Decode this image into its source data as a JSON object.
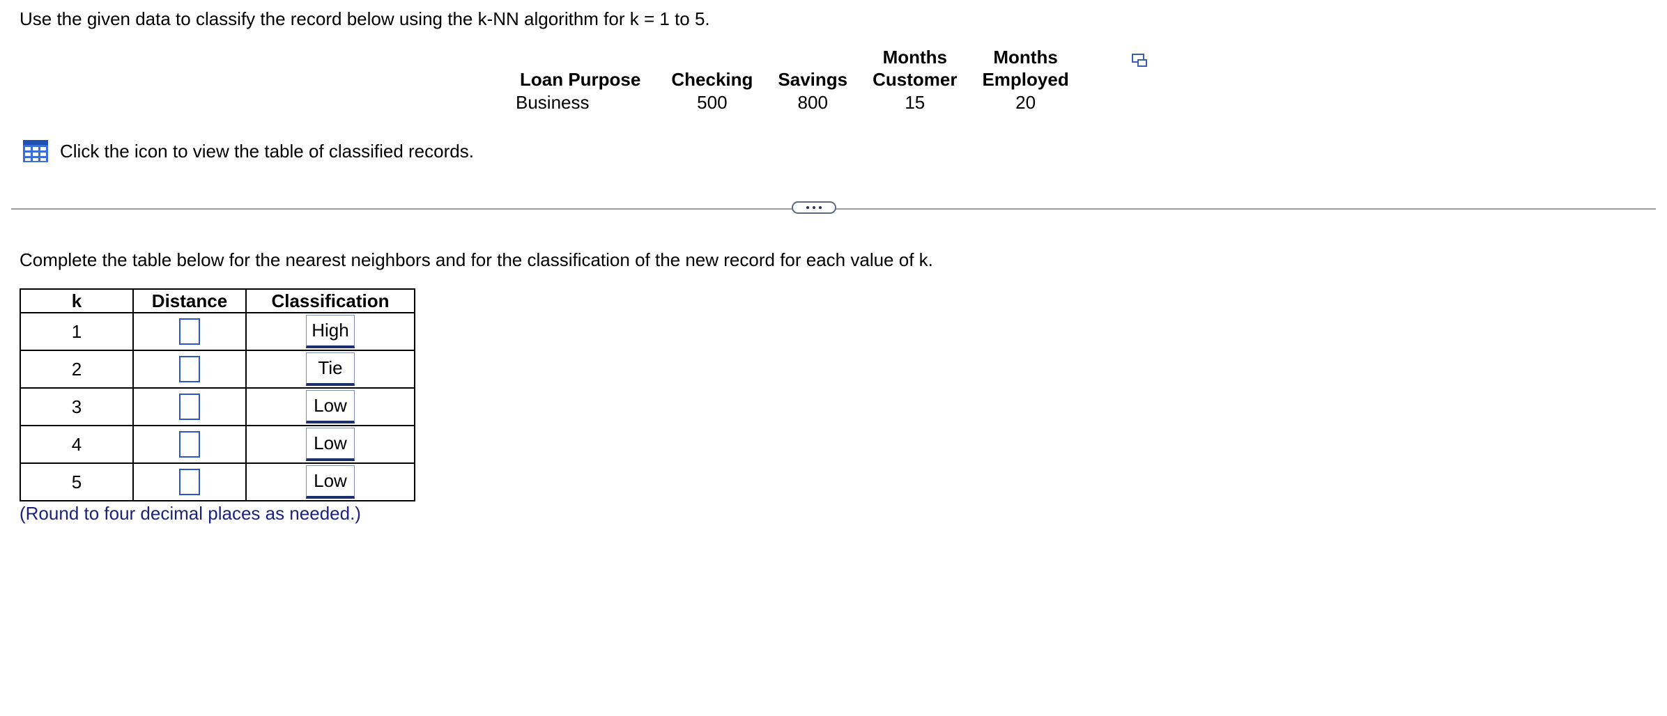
{
  "question": {
    "intro": "Use the given data to classify the record below using the k-NN algorithm for k = 1 to 5."
  },
  "record": {
    "headers": {
      "loan_purpose": "Loan Purpose",
      "checking": "Checking",
      "savings": "Savings",
      "months_customer_line1": "Months",
      "months_customer_line2": "Customer",
      "months_employed_line1": "Months",
      "months_employed_line2": "Employed"
    },
    "values": {
      "loan_purpose": "Business",
      "checking": "500",
      "savings": "800",
      "months_customer": "15",
      "months_employed": "20"
    },
    "copy_icon": "copy-data-icon"
  },
  "view_table": {
    "icon": "table-grid-icon",
    "label": "Click the icon to view the table of classified records."
  },
  "divider": {
    "expand_button_icon": "ellipsis-icon"
  },
  "instruction": "Complete the table below for the nearest neighbors and for the classification of the new record for each value of k.",
  "knn_table": {
    "headers": {
      "k": "k",
      "distance": "Distance",
      "classification": "Classification"
    },
    "rows": [
      {
        "k": "1",
        "distance": "",
        "classification": "High"
      },
      {
        "k": "2",
        "distance": "",
        "classification": "Tie"
      },
      {
        "k": "3",
        "distance": "",
        "classification": "Low"
      },
      {
        "k": "4",
        "distance": "",
        "classification": "Low"
      },
      {
        "k": "5",
        "distance": "",
        "classification": "Low"
      }
    ]
  },
  "note": "(Round to four decimal places as needed.)",
  "colors": {
    "input_border": "#2f55c8",
    "note_text": "#1a237e",
    "grid_icon": "#3b6fd6"
  }
}
